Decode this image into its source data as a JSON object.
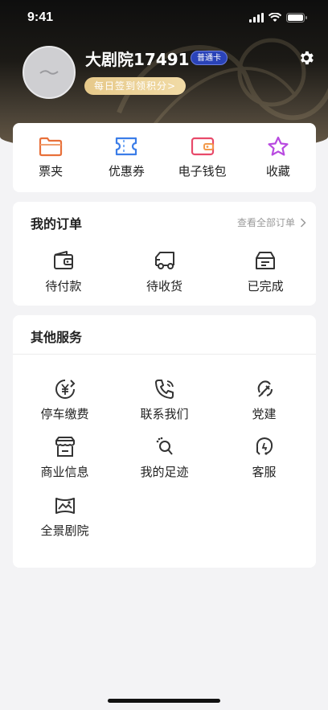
{
  "status_bar": {
    "time": "9:41"
  },
  "profile": {
    "username": "大剧院17491",
    "member_badge": "普通卡",
    "checkin_label": "每日签到领积分>"
  },
  "quick_actions": [
    {
      "label": "票夹",
      "icon": "folder-icon",
      "color": "#e8703a"
    },
    {
      "label": "优惠券",
      "icon": "ticket-icon",
      "color": "#3b7de8"
    },
    {
      "label": "电子钱包",
      "icon": "wallet-icon",
      "color": "#e84a6a"
    },
    {
      "label": "收藏",
      "icon": "star-icon",
      "color": "#b84ae0"
    }
  ],
  "orders": {
    "title": "我的订单",
    "view_all": "查看全部订单",
    "items": [
      {
        "label": "待付款",
        "icon": "wallet-outline-icon"
      },
      {
        "label": "待收货",
        "icon": "truck-icon"
      },
      {
        "label": "已完成",
        "icon": "box-icon"
      }
    ]
  },
  "services": {
    "title": "其他服务",
    "items": [
      {
        "label": "停车缴费",
        "icon": "parking-payment-icon"
      },
      {
        "label": "联系我们",
        "icon": "phone-icon"
      },
      {
        "label": "党建",
        "icon": "party-emblem-icon"
      },
      {
        "label": "商业信息",
        "icon": "store-icon"
      },
      {
        "label": "我的足迹",
        "icon": "footprint-icon"
      },
      {
        "label": "客服",
        "icon": "customer-service-icon"
      },
      {
        "label": "全景剧院",
        "icon": "panorama-icon"
      }
    ]
  }
}
